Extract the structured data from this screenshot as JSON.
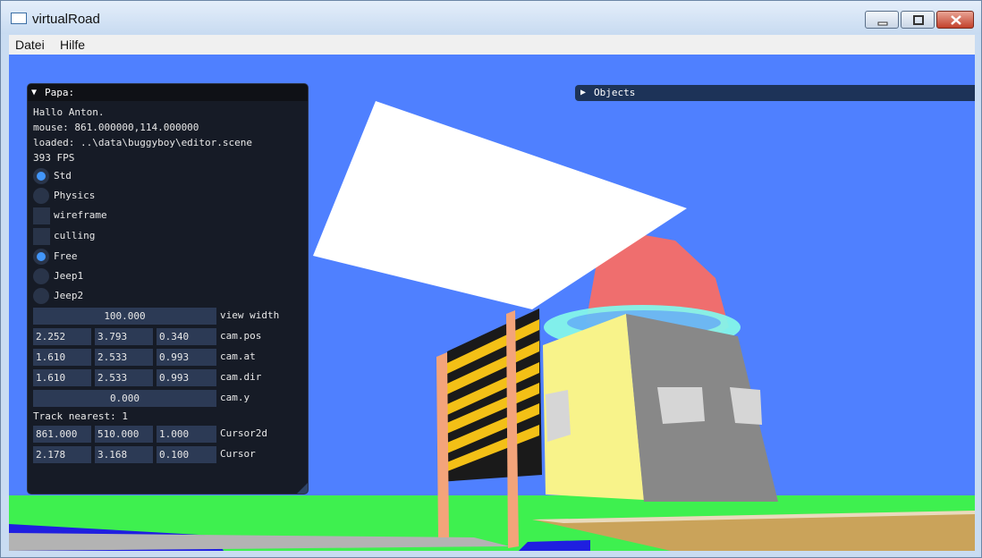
{
  "window": {
    "title": "virtualRoad"
  },
  "menubar": {
    "items": [
      {
        "label": "Datei"
      },
      {
        "label": "Hilfe"
      }
    ]
  },
  "panel": {
    "title": "Papa:",
    "lines": [
      "Hallo Anton.",
      "mouse: 861.000000,114.000000",
      "loaded: ..\\data\\buggyboy\\editor.scene",
      "393 FPS"
    ],
    "render_modes": [
      {
        "label": "Std",
        "selected": true
      },
      {
        "label": "Physics",
        "selected": false
      }
    ],
    "toggles": [
      {
        "label": "wireframe",
        "checked": false
      },
      {
        "label": "culling",
        "checked": false
      }
    ],
    "camera_modes": [
      {
        "label": "Free",
        "selected": true
      },
      {
        "label": "Jeep1",
        "selected": false
      },
      {
        "label": "Jeep2",
        "selected": false
      }
    ],
    "view_width": {
      "value": "100.000",
      "label": "view width"
    },
    "cam_pos": {
      "values": [
        "2.252",
        "3.793",
        "0.340"
      ],
      "label": "cam.pos"
    },
    "cam_at": {
      "values": [
        "1.610",
        "2.533",
        "0.993"
      ],
      "label": "cam.at"
    },
    "cam_dir": {
      "values": [
        "1.610",
        "2.533",
        "0.993"
      ],
      "label": "cam.dir"
    },
    "cam_y": {
      "value": "0.000",
      "label": "cam.y"
    },
    "track_nearest": "Track nearest: 1",
    "cursor2d": {
      "values": [
        "861.000",
        "510.000",
        "1.000"
      ],
      "label": "Cursor2d"
    },
    "cursor": {
      "values": [
        "2.178",
        "3.168",
        "0.100"
      ],
      "label": "Cursor"
    }
  },
  "objects_panel": {
    "title": "Objects",
    "collapsed": true
  },
  "colors": {
    "sky": "#4f80ff",
    "ground": "#3ef04f",
    "accent": "#4296fa",
    "panel_bg": "#161b26",
    "field_bg": "#2c3a55"
  }
}
